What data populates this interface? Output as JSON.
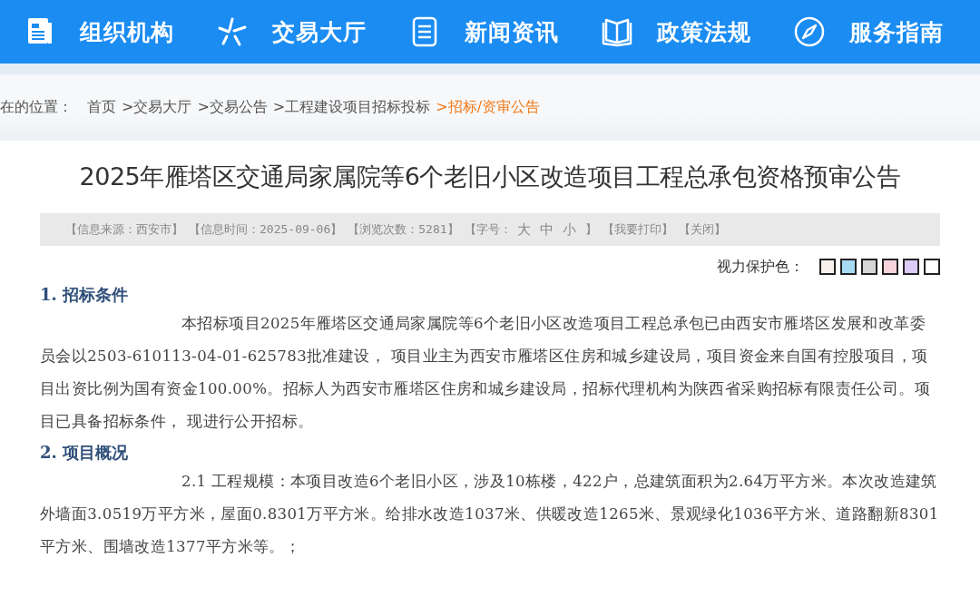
{
  "nav": [
    {
      "label": "组织机构",
      "kind": "document"
    },
    {
      "label": "交易大厅",
      "kind": "star"
    },
    {
      "label": "新闻资讯",
      "kind": "list"
    },
    {
      "label": "政策法规",
      "kind": "book"
    },
    {
      "label": "服务指南",
      "kind": "compass"
    }
  ],
  "breadcrumb": {
    "label": "在的位置：",
    "items": [
      {
        "text": "首页",
        "current": false
      },
      {
        "text": ">交易大厅",
        "current": false
      },
      {
        "text": ">交易公告",
        "current": false
      },
      {
        "text": ">工程建设项目招标投标",
        "current": false
      },
      {
        "text": ">招标/资审公告",
        "current": true
      }
    ]
  },
  "title": "2025年雁塔区交通局家属院等6个老旧小区改造项目工程总承包资格预审公告",
  "info_bar": {
    "source": "【信息来源：西安市】",
    "time": "【信息时间：2025-09-06】",
    "views": "【浏览次数：5281】",
    "font_size_label": "【字号：",
    "font_sizes": [
      "大",
      "中",
      "小"
    ],
    "font_size_end": "】",
    "print": "【我要打印】",
    "close": "【关闭】"
  },
  "eye_protection": {
    "label": "视力保护色：",
    "swatches": [
      {
        "color": "#f7f2ec"
      },
      {
        "color": "#a6dbf3"
      },
      {
        "color": "#d6d6d6"
      },
      {
        "color": "#f7d3dc"
      },
      {
        "color": "#dccbf6"
      },
      {
        "color": "#ffffff"
      }
    ]
  },
  "sections": [
    {
      "heading": "1. 招标条件",
      "paragraphs": [
        "本招标项目2025年雁塔区交通局家属院等6个老旧小区改造项目工程总承包已由西安市雁塔区发展和改革委员会以2503-610113-04-01-625783批准建设， 项目业主为西安市雁塔区住房和城乡建设局，项目资金来自国有控股项目，项目出资比例为国有资金100.00%。招标人为西安市雁塔区住房和城乡建设局，招标代理机构为陕西省采购招标有限责任公司。项目已具备招标条件， 现进行公开招标。"
      ]
    },
    {
      "heading": "2. 项目概况",
      "paragraphs": [
        "2.1 工程规模：本项目改造6个老旧小区，涉及10栋楼，422户，总建筑面积为2.64万平方米。本次改造建筑外墙面3.0519万平方米，屋面0.8301万平方米。给排水改造1037米、供暖改造1265米、景观绿化1036平方米、道路翻新8301平方米、围墙改造1377平方米等。；"
      ]
    }
  ]
}
